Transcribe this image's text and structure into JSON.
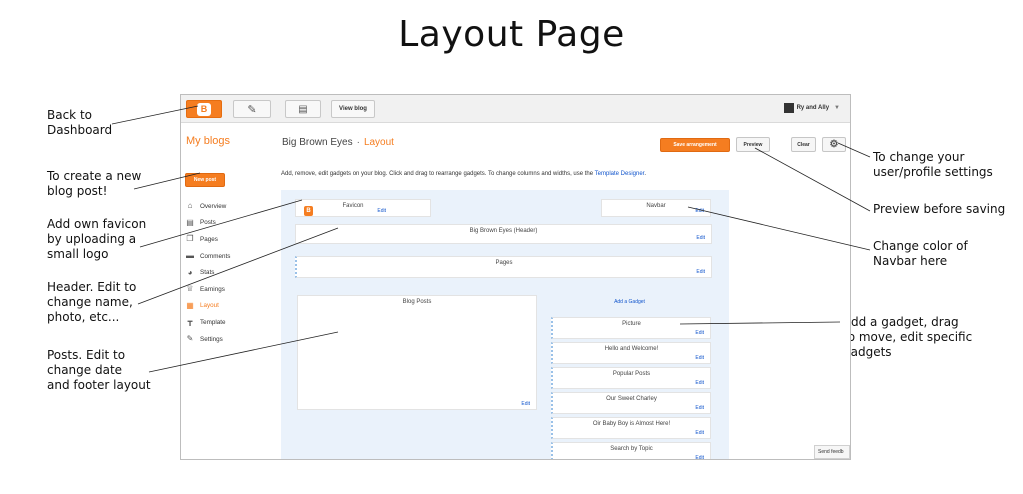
{
  "slide": {
    "title": "Layout Page"
  },
  "annotations": {
    "back": "Back to\nDashboard",
    "newpost": "To create a new\nblog post!",
    "favicon": "Add own favicon\nby uploading a\nsmall logo",
    "header": "Header. Edit to\nchange name,\nphoto, etc...",
    "posts": "Posts. Edit to\nchange date\nand footer layout",
    "settings": "To change your\nuser/profile settings",
    "preview": "Preview before saving",
    "navbar": "Change color of\nNavbar here",
    "gadget": "Add a gadget, drag\nto move, edit specific\ngadgets"
  },
  "topbar": {
    "view_blog": "View blog",
    "user": "Ry and Ally"
  },
  "header": {
    "my_blogs": "My blogs",
    "blog_name": "Big Brown Eyes",
    "separator": "·",
    "section": "Layout",
    "save": "Save arrangement",
    "preview": "Preview",
    "clear": "Clear"
  },
  "sidebar": {
    "new_post": "New post",
    "items": [
      {
        "label": "Overview",
        "icon": "home-icon",
        "glyph": "⌂"
      },
      {
        "label": "Posts",
        "icon": "posts-icon",
        "glyph": "▤"
      },
      {
        "label": "Pages",
        "icon": "pages-icon",
        "glyph": "❐"
      },
      {
        "label": "Comments",
        "icon": "comments-icon",
        "glyph": "▬"
      },
      {
        "label": "Stats",
        "icon": "stats-icon",
        "glyph": "◕"
      },
      {
        "label": "Earnings",
        "icon": "earnings-icon",
        "glyph": "♕"
      },
      {
        "label": "Layout",
        "icon": "layout-icon",
        "glyph": "▦"
      },
      {
        "label": "Template",
        "icon": "template-icon",
        "glyph": "┳"
      },
      {
        "label": "Settings",
        "icon": "wrench-icon",
        "glyph": "✎"
      }
    ]
  },
  "help": {
    "text": "Add, remove, edit gadgets on your blog. Click and drag to rearrange gadgets. To change columns and widths, use the",
    "link": "Template Designer",
    "end": "."
  },
  "gadgets": {
    "edit": "Edit",
    "favicon": "Favicon",
    "navbar": "Navbar",
    "header": "Big Brown Eyes (Header)",
    "pages": "Pages",
    "blog_posts": "Blog Posts",
    "add_gadget": "Add a Gadget",
    "sidebar_gadgets": [
      "Picture",
      "Hello and Welcome!",
      "Popular Posts",
      "Our Sweet Charley",
      "Oir Baby Boy is Almost Here!",
      "Search by Topic"
    ]
  },
  "footer": {
    "send_feedback": "Send feedb"
  },
  "colors": {
    "accent": "#f57d20",
    "link": "#1155cc",
    "editor_bg": "#eaf2fb"
  }
}
